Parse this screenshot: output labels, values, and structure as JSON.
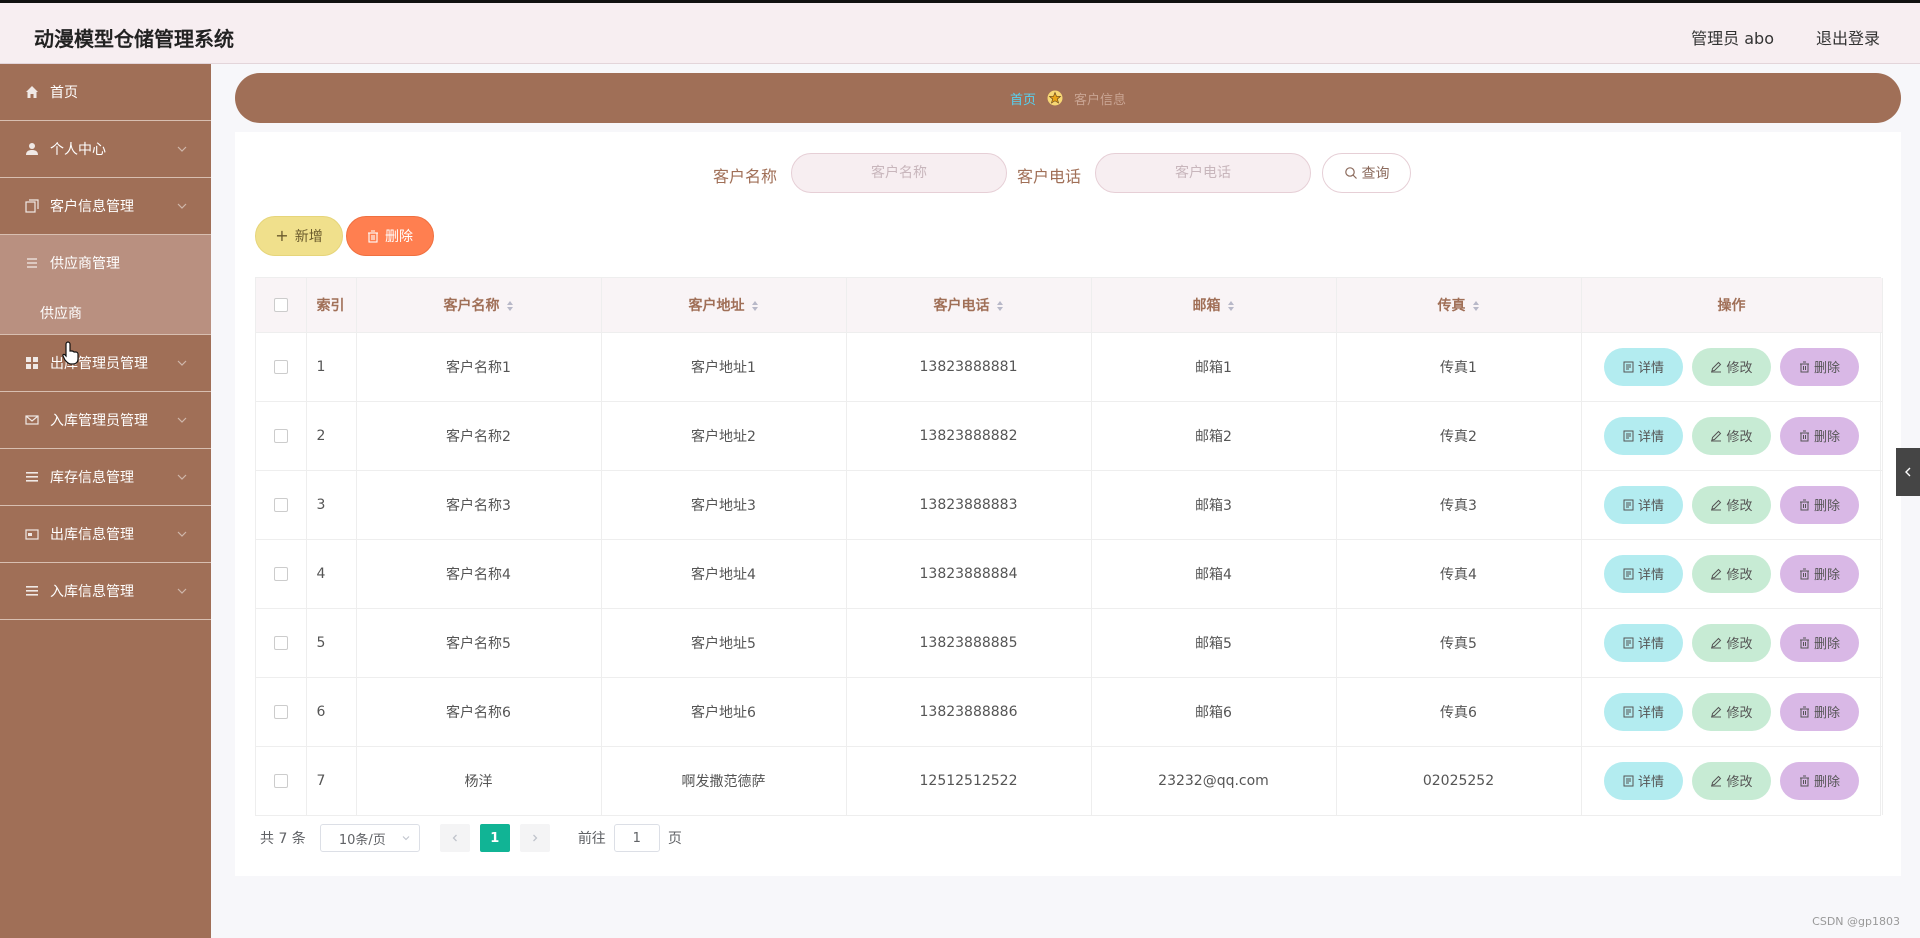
{
  "header": {
    "app_title": "动漫模型仓储管理系统",
    "user_info": "管理员 abo",
    "logout": "退出登录"
  },
  "sidebar": {
    "items": [
      {
        "label": "首页",
        "icon": "home-icon"
      },
      {
        "label": "个人中心",
        "icon": "user-icon"
      },
      {
        "label": "客户信息管理",
        "icon": "copy-icon"
      },
      {
        "label": "供应商管理",
        "icon": "list-icon",
        "open": true,
        "sub": [
          "供应商"
        ]
      },
      {
        "label": "出库管理员管理",
        "icon": "grid-icon"
      },
      {
        "label": "入库管理员管理",
        "icon": "mail-icon"
      },
      {
        "label": "库存信息管理",
        "icon": "menu-icon"
      },
      {
        "label": "出库信息管理",
        "icon": "card-icon"
      },
      {
        "label": "入库信息管理",
        "icon": "menu-icon"
      }
    ],
    "submenu_label": "供应商"
  },
  "breadcrumb": {
    "home": "首页",
    "current": "客户信息"
  },
  "search": {
    "name_label": "客户名称",
    "name_placeholder": "客户名称",
    "phone_label": "客户电话",
    "phone_placeholder": "客户电话",
    "query_label": "查询"
  },
  "actions": {
    "add_label": "新增",
    "delete_label": "删除"
  },
  "table": {
    "columns": [
      "索引",
      "客户名称",
      "客户地址",
      "客户电话",
      "邮箱",
      "传真",
      "操作"
    ],
    "rows": [
      {
        "idx": "1",
        "name": "客户名称1",
        "address": "客户地址1",
        "phone": "13823888881",
        "email": "邮箱1",
        "fax": "传真1"
      },
      {
        "idx": "2",
        "name": "客户名称2",
        "address": "客户地址2",
        "phone": "13823888882",
        "email": "邮箱2",
        "fax": "传真2"
      },
      {
        "idx": "3",
        "name": "客户名称3",
        "address": "客户地址3",
        "phone": "13823888883",
        "email": "邮箱3",
        "fax": "传真3"
      },
      {
        "idx": "4",
        "name": "客户名称4",
        "address": "客户地址4",
        "phone": "13823888884",
        "email": "邮箱4",
        "fax": "传真4"
      },
      {
        "idx": "5",
        "name": "客户名称5",
        "address": "客户地址5",
        "phone": "13823888885",
        "email": "邮箱5",
        "fax": "传真5"
      },
      {
        "idx": "6",
        "name": "客户名称6",
        "address": "客户地址6",
        "phone": "13823888886",
        "email": "邮箱6",
        "fax": "传真6"
      },
      {
        "idx": "7",
        "name": "杨洋",
        "address": "啊发撒范德萨",
        "phone": "12512512522",
        "email": "23232@qq.com",
        "fax": "02025252"
      }
    ],
    "row_actions": {
      "detail": "详情",
      "edit": "修改",
      "remove": "删除"
    }
  },
  "pagination": {
    "total": "共 7 条",
    "page_size": "10条/页",
    "current_page": "1",
    "goto_label": "前往",
    "goto_value": "1",
    "page_suffix": "页"
  },
  "watermark": "CSDN @gp1803",
  "colors": {
    "brand": "#a06f57",
    "header_bg": "#f7eef1",
    "accent_link": "#56d2f2",
    "add_button": "#f0e08c",
    "delete_button": "#ff7f50",
    "detail_button": "#b3ecf0",
    "edit_button": "#c7ebd4",
    "remove_button": "#d9b8e6",
    "page_active": "#11b495"
  }
}
